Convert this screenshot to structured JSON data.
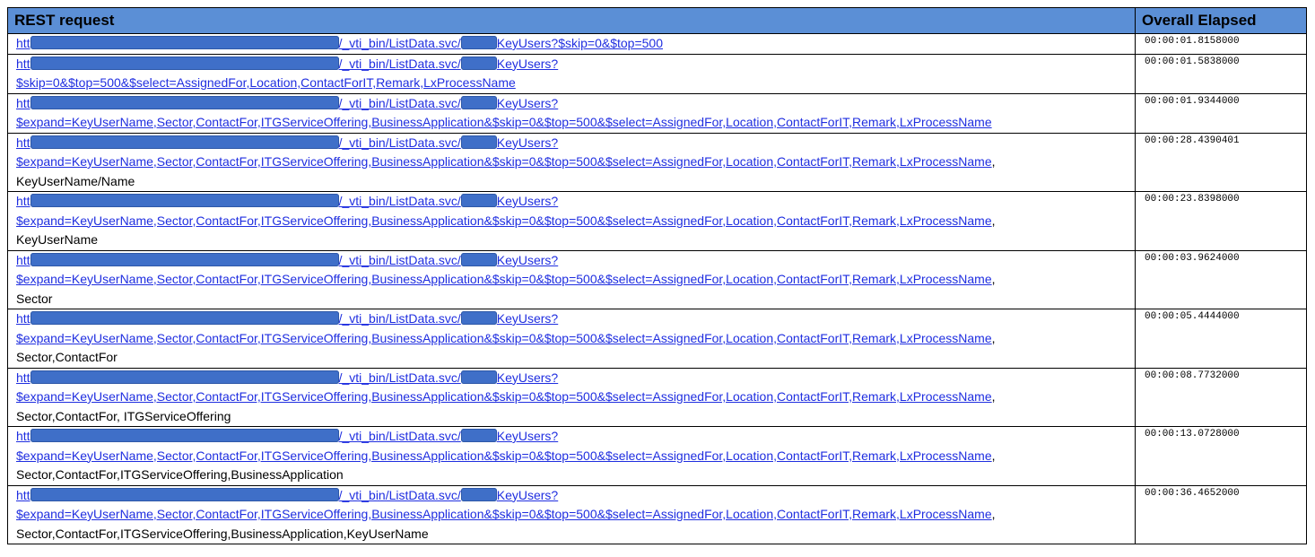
{
  "headers": {
    "request": "REST request",
    "elapsed": "Overall Elapsed"
  },
  "rows": [
    {
      "prefix": "htt",
      "path": "/_vti_bin/ListData.svc/",
      "list": "KeyUsers?$skip=0&$top=500",
      "line2": "",
      "suffix": "",
      "elapsed": "00:00:01.8158000"
    },
    {
      "prefix": "htt",
      "path": "/_vti_bin/ListData.svc/",
      "list": "KeyUsers?",
      "line2": "$skip=0&$top=500&$select=AssignedFor,Location,ContactForIT,Remark,LxProcessName",
      "suffix": "",
      "elapsed": "00:00:01.5838000"
    },
    {
      "prefix": "htt",
      "path": "/_vti_bin/ListData.svc/",
      "list": "KeyUsers?",
      "line2": "$expand=KeyUserName,Sector,ContactFor,ITGServiceOffering,BusinessApplication&$skip=0&$top=500&$select=AssignedFor,Location,ContactForIT,Remark,LxProcessName",
      "suffix": "",
      "elapsed": "00:00:01.9344000"
    },
    {
      "prefix": "htt",
      "path": "/_vti_bin/ListData.svc/",
      "list": "KeyUsers?",
      "line2": "$expand=KeyUserName,Sector,ContactFor,ITGServiceOffering,BusinessApplication&$skip=0&$top=500&$select=AssignedFor,Location,ContactForIT,Remark,LxProcessName",
      "suffix": "KeyUserName/Name",
      "elapsed": "00:00:28.4390401"
    },
    {
      "prefix": "htt",
      "path": "/_vti_bin/ListData.svc/",
      "list": "KeyUsers?",
      "line2": "$expand=KeyUserName,Sector,ContactFor,ITGServiceOffering,BusinessApplication&$skip=0&$top=500&$select=AssignedFor,Location,ContactForIT,Remark,LxProcessName",
      "suffix": "KeyUserName",
      "elapsed": "00:00:23.8398000"
    },
    {
      "prefix": "htt",
      "path": "/_vti_bin/ListData.svc/",
      "list": "KeyUsers?",
      "line2": "$expand=KeyUserName,Sector,ContactFor,ITGServiceOffering,BusinessApplication&$skip=0&$top=500&$select=AssignedFor,Location,ContactForIT,Remark,LxProcessName",
      "suffix": "Sector",
      "elapsed": "00:00:03.9624000"
    },
    {
      "prefix": "htt",
      "path": "/_vti_bin/ListData.svc/",
      "list": "KeyUsers?",
      "line2": "$expand=KeyUserName,Sector,ContactFor,ITGServiceOffering,BusinessApplication&$skip=0&$top=500&$select=AssignedFor,Location,ContactForIT,Remark,LxProcessName",
      "suffix": "Sector,ContactFor",
      "elapsed": "00:00:05.4444000"
    },
    {
      "prefix": "htt",
      "path": "/_vti_bin/ListData.svc/",
      "list": "KeyUsers?",
      "line2": "$expand=KeyUserName,Sector,ContactFor,ITGServiceOffering,BusinessApplication&$skip=0&$top=500&$select=AssignedFor,Location,ContactForIT,Remark,LxProcessName",
      "suffix": "Sector,ContactFor, ITGServiceOffering",
      "elapsed": "00:00:08.7732000"
    },
    {
      "prefix": "htt",
      "path": "/_vti_bin/ListData.svc/",
      "list": "KeyUsers?",
      "line2": "$expand=KeyUserName,Sector,ContactFor,ITGServiceOffering,BusinessApplication&$skip=0&$top=500&$select=AssignedFor,Location,ContactForIT,Remark,LxProcessName",
      "suffix": "Sector,ContactFor,ITGServiceOffering,BusinessApplication",
      "elapsed": "00:00:13.0728000"
    },
    {
      "prefix": "htt",
      "path": "/_vti_bin/ListData.svc/",
      "list": "KeyUsers?",
      "line2": "$expand=KeyUserName,Sector,ContactFor,ITGServiceOffering,BusinessApplication&$skip=0&$top=500&$select=AssignedFor,Location,ContactForIT,Remark,LxProcessName",
      "suffix": "Sector,ContactFor,ITGServiceOffering,BusinessApplication,KeyUserName",
      "elapsed": "00:00:36.4652000"
    }
  ],
  "colors": {
    "header_bg": "#5b8fd6",
    "link": "#1f2ee0",
    "redaction": "#3f6fc8"
  }
}
